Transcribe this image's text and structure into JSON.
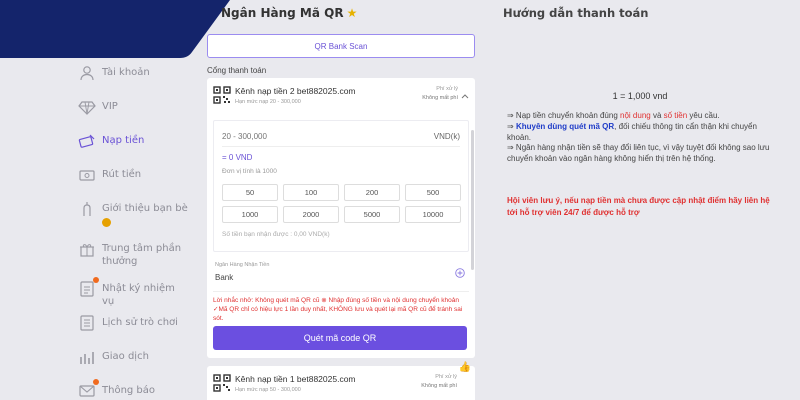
{
  "colors": {
    "banner": "#14246b",
    "accent": "#6a52d6",
    "primary_button": "#6b4fe0",
    "warning": "#e03131",
    "notification_dot": "#f06a1e"
  },
  "sidebar": {
    "items": [
      {
        "label": "Tài khoản",
        "icon": "user-icon",
        "active": false
      },
      {
        "label": "VIP",
        "icon": "diamond-icon",
        "active": false
      },
      {
        "label": "Nạp tiền",
        "icon": "deposit-icon",
        "active": true
      },
      {
        "label": "Rút tiền",
        "icon": "withdraw-icon",
        "active": false
      },
      {
        "label": "Giới thiệu bạn bè",
        "icon": "referral-icon",
        "active": false
      },
      {
        "label": "Trung tâm phần thưởng",
        "icon": "gift-icon",
        "active": false
      },
      {
        "label": "Nhật ký nhiệm vụ",
        "icon": "task-log-icon",
        "active": false
      },
      {
        "label": "Lịch sử trò chơi",
        "icon": "game-history-icon",
        "active": false
      },
      {
        "label": "Giao dịch",
        "icon": "transaction-icon",
        "active": false
      },
      {
        "label": "Thông báo",
        "icon": "mail-icon",
        "active": false
      }
    ]
  },
  "center": {
    "title": "Ngân Hàng Mã QR",
    "qr_bank_scan": "QR Bank Scan",
    "section_label": "Cổng thanh toán",
    "channel1": {
      "name": "Kênh nạp tiền 2 bet882025.com",
      "limit": "Hạn mức nạp 20 - 300,000",
      "fee_label": "Phí xử lý",
      "fee_value": "Không mất phí"
    },
    "form": {
      "amount_placeholder": "20 - 300,000",
      "amount_unit": "VND(k)",
      "equivalent": "= 0 VND",
      "unit_note": "Đơn vị tính là 1000",
      "chips": [
        "50",
        "100",
        "200",
        "500",
        "1000",
        "2000",
        "5000",
        "10000"
      ],
      "received": "Số tiền bạn nhận được : 0,00 VND(k)"
    },
    "bank": {
      "label": "Ngân Hàng Nhận Tiền",
      "value": "Bank"
    },
    "warning": "Lời nhắc nhở: Không quét mã QR cũ ⊗ Nhập đúng số tiền và nội dung chuyển khoản ✓Mã QR chỉ có hiệu lực 1 lần duy nhất, KHÔNG lưu và quét lại mã QR cũ để tránh sai sót.",
    "scan_button": "Quét mã code QR",
    "channel2": {
      "name": "Kênh nạp tiền 1 bet882025.com",
      "limit": "Hạn mức nạp 50 - 300,000",
      "fee_label": "Phí xử lý",
      "fee_value": "Không mất phí"
    }
  },
  "guide": {
    "title": "Hướng dẫn thanh toán",
    "rate": "1 = 1,000 vnd",
    "line1_a": "⇒ Nạp tiền chuyển khoản đúng ",
    "line1_b": "nội dung",
    "line1_c": " và ",
    "line1_d": "số tiền",
    "line1_e": " yêu cầu.",
    "line2_a": "⇒ ",
    "line2_b": "Khuyên dùng quét mã QR",
    "line2_c": ", đối chiếu thông tin cẩn thận khi chuyển khoản.",
    "line3": "⇒ Ngân hàng nhận tiền sẽ thay đổi liên tục, vì vậy tuyệt đối không sao lưu chuyển khoản vào ngân hàng không hiển thị trên hệ thống.",
    "note": "Hội viên lưu ý, nếu nạp tiền mà chưa được cập nhật điểm hãy liên hệ tới hỗ trợ viên 24/7 để được hỗ trợ"
  }
}
